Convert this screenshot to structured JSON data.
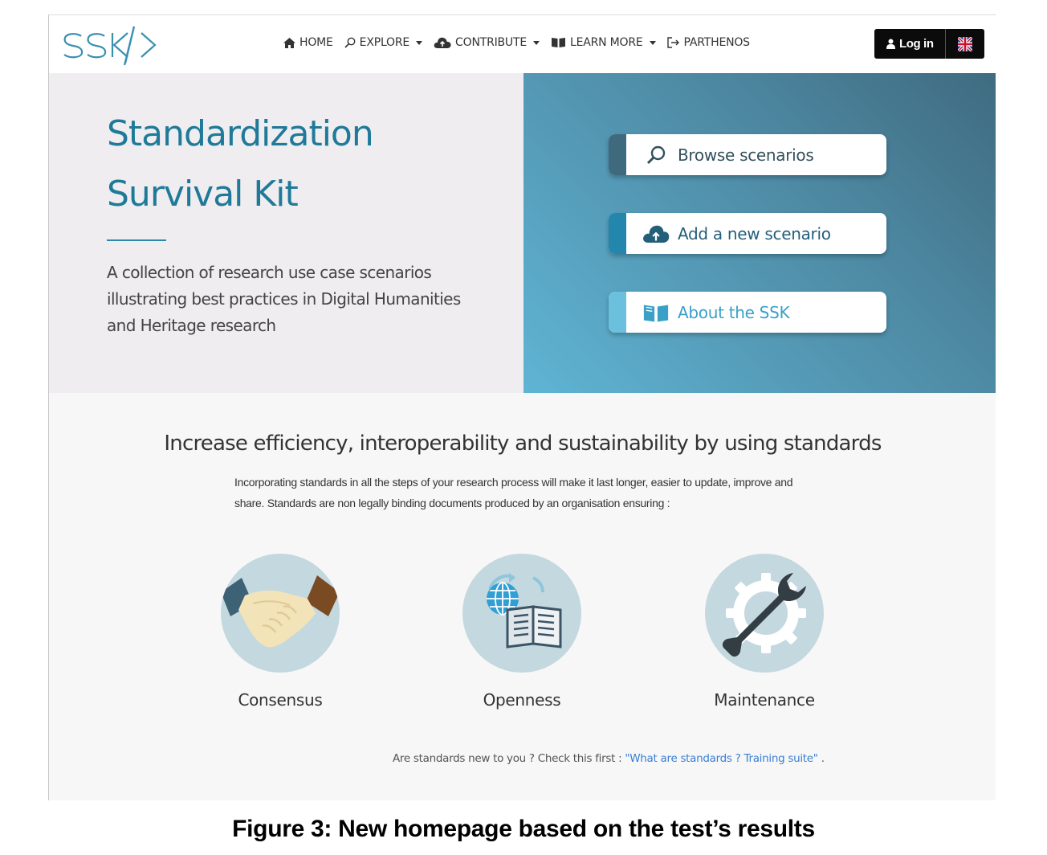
{
  "logo": {
    "text": "SSK"
  },
  "nav": {
    "home": "HOME",
    "explore": "EXPLORE",
    "contribute": "CONTRIBUTE",
    "learn_more": "LEARN MORE",
    "parthenos": "PARTHENOS"
  },
  "auth": {
    "login_label": "Log in",
    "language": "en-GB"
  },
  "hero": {
    "title_line1": "Standardization",
    "title_line2": "Survival Kit",
    "description": "A collection of research use case scenarios illustrating best practices in Digital Humanities and Heritage research",
    "actions": [
      {
        "label": "Browse scenarios",
        "icon": "search-icon",
        "accent": "#3f6a7e",
        "color": "#33505e"
      },
      {
        "label": "Add a new scenario",
        "icon": "cloud-upload-icon",
        "accent": "#2386ad",
        "color": "#245f7a"
      },
      {
        "label": "About the SSK",
        "icon": "book-icon",
        "accent": "#6bc0dd",
        "color": "#3aa0c8"
      }
    ]
  },
  "section": {
    "heading": "Increase efficiency, interoperability and sustainability by using standards",
    "text": "Incorporating standards in all the steps of your research process will make it last longer, easier to update, improve and share. Standards are non legally binding documents produced by an organisation ensuring :"
  },
  "features": [
    {
      "label": "Consensus",
      "icon": "handshake-icon"
    },
    {
      "label": "Openness",
      "icon": "globe-book-icon"
    },
    {
      "label": "Maintenance",
      "icon": "wrench-gear-icon"
    }
  ],
  "footer_note": {
    "text": "Are standards new to you ? Check this first : ",
    "link": "\"What are standards ? Training suite\"",
    "suffix": " ."
  },
  "caption": "Figure 3: New homepage based on the test’s results",
  "colors": {
    "title": "#1f7a99",
    "hero_left_bg": "#efedef",
    "link": "#3a7fd5",
    "icon_circle": "#c4d8df"
  }
}
